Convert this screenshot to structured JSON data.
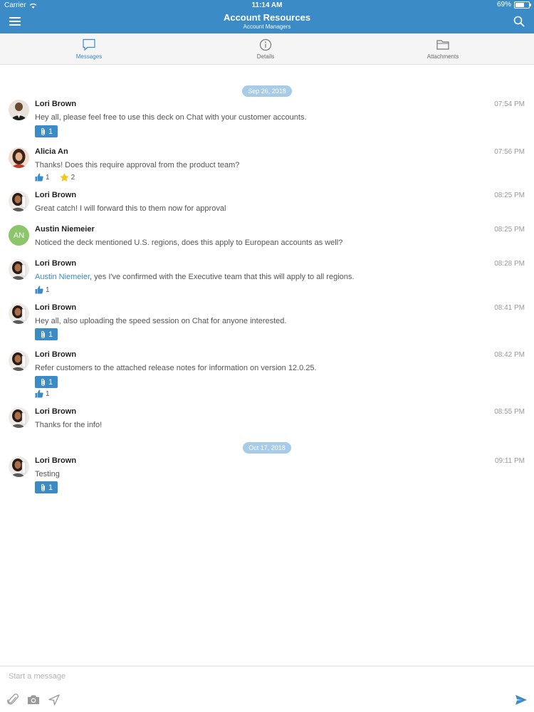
{
  "status_bar": {
    "carrier": "Carrier",
    "time": "11:14 AM",
    "battery": "69%",
    "battery_level": 0.69
  },
  "header": {
    "title": "Account Resources",
    "subtitle": "Account Managers",
    "menu_icon": "hamburger-icon",
    "search_icon": "search-icon"
  },
  "tabs": [
    {
      "label": "Messages",
      "icon": "chat-bubble-icon",
      "active": true
    },
    {
      "label": "Details",
      "icon": "info-icon",
      "active": false
    },
    {
      "label": "Attachments",
      "icon": "folder-icon",
      "active": false
    }
  ],
  "date_separators": [
    "Sep 26, 2018",
    "Oct 17, 2018"
  ],
  "messages": [
    {
      "author": "Lori Brown",
      "time": "07:54 PM",
      "text": "Hey all, please feel free to use this deck on Chat with your customer accounts.",
      "attachments": "1"
    },
    {
      "author": "Alicia An",
      "time": "07:56 PM",
      "text": "Thanks! Does this require approval from the product team?",
      "thumbs": "1",
      "stars": "2"
    },
    {
      "author": "Lori Brown",
      "time": "08:25 PM",
      "text": "Great catch! I will forward this to them now for approval"
    },
    {
      "author": "Austin Niemeier",
      "initials": "AN",
      "time": "08:25 PM",
      "text": "Noticed the deck mentioned U.S. regions, does this apply to European accounts as well?"
    },
    {
      "author": "Lori Brown",
      "time": "08:28 PM",
      "mention": "Austin Niemeier",
      "text": ", yes I've confirmed with the Executive team that this will apply to all regions.",
      "thumbs": "1"
    },
    {
      "author": "Lori Brown",
      "time": "08:41 PM",
      "text": "Hey all, also uploading the speed session on Chat for anyone interested.",
      "attachments": "1"
    },
    {
      "author": "Lori Brown",
      "time": "08:42 PM",
      "text": "Refer customers to the attached release notes for information on version 12.0.25.",
      "attachments": "1",
      "thumbs": "1"
    },
    {
      "author": "Lori Brown",
      "time": "08:55 PM",
      "text": "Thanks for the info!"
    },
    {
      "author": "Lori Brown",
      "time": "09:11 PM",
      "text": "Testing",
      "attachments": "1"
    }
  ],
  "composer": {
    "placeholder": "Start a message",
    "icons": [
      "paperclip-icon",
      "camera-icon",
      "location-icon",
      "send-icon"
    ]
  },
  "colors": {
    "brand": "#3b8bc6",
    "date_pill": "#a8cbe8",
    "initials_avatar": "#8cc56a",
    "star": "#f5c518"
  }
}
